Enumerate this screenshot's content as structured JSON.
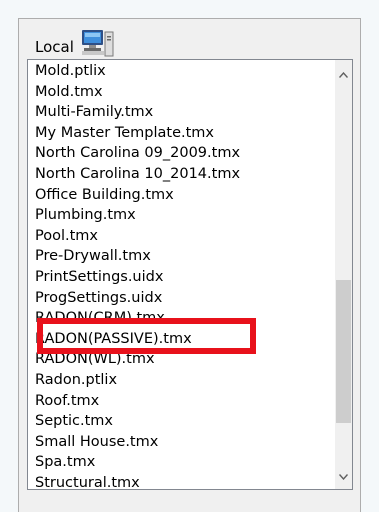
{
  "header": {
    "label": "Local",
    "icon": "computer-icon"
  },
  "file_list": {
    "items": [
      "Mold.ptlix",
      "Mold.tmx",
      "Multi-Family.tmx",
      "My Master Template.tmx",
      "North Carolina 09_2009.tmx",
      "North Carolina 10_2014.tmx",
      "Office Building.tmx",
      "Plumbing.tmx",
      "Pool.tmx",
      "Pre-Drywall.tmx",
      "PrintSettings.uidx",
      "ProgSettings.uidx",
      "RADON(CRM).tmx",
      "RADON(PASSIVE).tmx",
      "RADON(WL).tmx",
      "Radon.ptlix",
      "Roof.tmx",
      "Septic.tmx",
      "Small House.tmx",
      "Spa.tmx",
      "Structural.tmx"
    ],
    "highlighted": "PrintSettings.uidx",
    "highlight_color": "#e8111b"
  }
}
